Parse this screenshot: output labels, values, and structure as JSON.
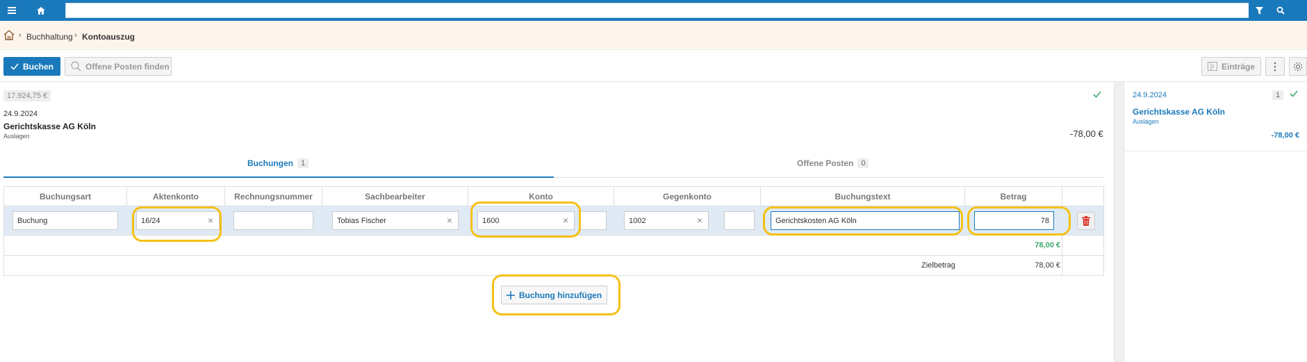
{
  "topbar": {
    "menu_icon": "menu-icon",
    "home_icon": "home-icon",
    "search_value": "",
    "filter_icon": "filter-icon",
    "search_icon": "search-icon"
  },
  "breadcrumb": {
    "items": [
      "Buchhaltung",
      "Kontoauszug"
    ]
  },
  "toolbar": {
    "book_label": "Buchen",
    "find_open_label": "Offene Posten finden",
    "entries_label": "Einträge"
  },
  "statement": {
    "balance": "17.924,75 €",
    "date": "24.9.2024",
    "name": "Gerichtskasse AG Köln",
    "subtitle": "Auslagen",
    "amount": "-78,00 €"
  },
  "tabs": [
    {
      "label": "Buchungen",
      "count": "1"
    },
    {
      "label": "Offene Posten",
      "count": "0"
    }
  ],
  "table": {
    "headers": [
      "Buchungsart",
      "Aktenkonto",
      "Rechnungsnummer",
      "Sachbearbeiter",
      "Konto",
      "Gegenkonto",
      "Buchungstext",
      "Betrag"
    ],
    "row": {
      "buchungsart": "Buchung",
      "aktenkonto": "16/24",
      "rechnungsnummer": "",
      "sachbearbeiter": "Tobias Fischer",
      "konto": "1600",
      "gegenkonto": "1002",
      "buchungstext": "Gerichtskosten AG Köln",
      "betrag": "78"
    },
    "sum": "78,00 €",
    "target_label": "Zielbetrag",
    "target_value": "78,00 €"
  },
  "add_booking_label": "Buchung hinzufügen",
  "right_panel": {
    "date": "24.9.2024",
    "count": "1",
    "name": "Gerichtskasse AG Köln",
    "subtitle": "Auslagen",
    "amount": "-78,00 €"
  },
  "colors": {
    "accent": "#1a79bb",
    "success": "#3aa76d",
    "highlight": "#f5c013",
    "danger": "#d9342b"
  }
}
